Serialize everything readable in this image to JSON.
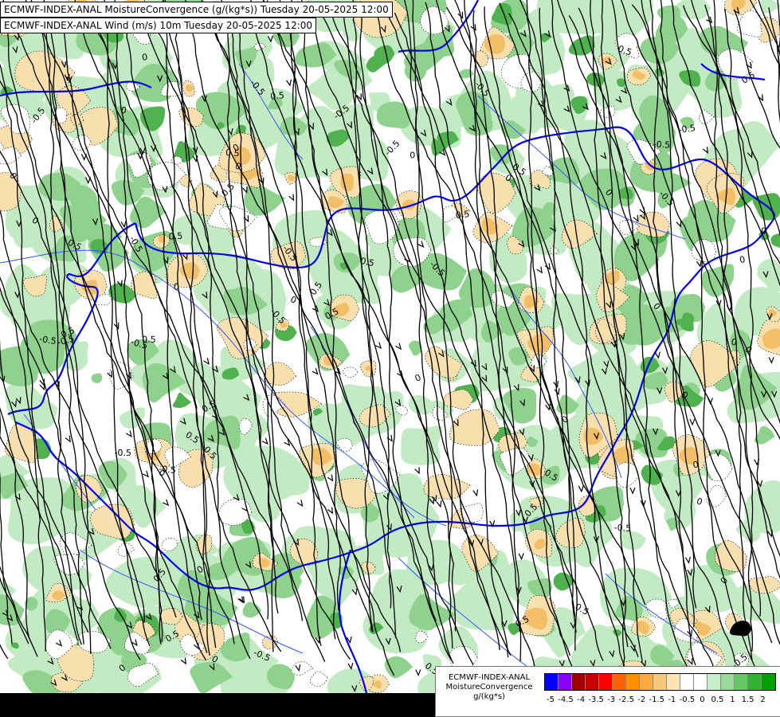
{
  "titles": {
    "line1": "ECMWF-INDEX-ANAL MoistureConvergence (g/(kg*s)) Tuesday 20-05-2025 12:00",
    "line2": "ECMWF-INDEX-ANAL Wind (m/s) 10m Tuesday 20-05-2025 12:00"
  },
  "legend": {
    "model": "ECMWF-INDEX-ANAL",
    "parameter": "MoistureConvergence",
    "unit": "g/(kg*s)",
    "colors": [
      "#0000ff",
      "#8b00ff",
      "#a00000",
      "#c80000",
      "#ff0000",
      "#ff6000",
      "#ff9000",
      "#ffaa40",
      "#f5c87a",
      "#ffe4b4",
      "#ffffff",
      "#ffffff",
      "#c8f0c8",
      "#96dc96",
      "#64c864",
      "#32b432",
      "#00a000"
    ],
    "tick_labels": [
      "-5",
      "-4.5",
      "-4",
      "-3.5",
      "-3",
      "-2.5",
      "-2",
      "-1.5",
      "-1",
      "-0.5",
      "0",
      "0.5",
      "1",
      "1.5",
      "2"
    ]
  },
  "map": {
    "contour_labels": [
      "0",
      "0.5",
      "-0.5"
    ],
    "colors": {
      "border": "#0000ee",
      "river": "#3355ff",
      "streamline": "#000000",
      "positive_light": "#c3ebc3",
      "positive_mid": "#8ed28e",
      "positive_dark": "#4fb24f",
      "negative_light": "#f7dfae",
      "negative_mid": "#f2bf66"
    }
  }
}
